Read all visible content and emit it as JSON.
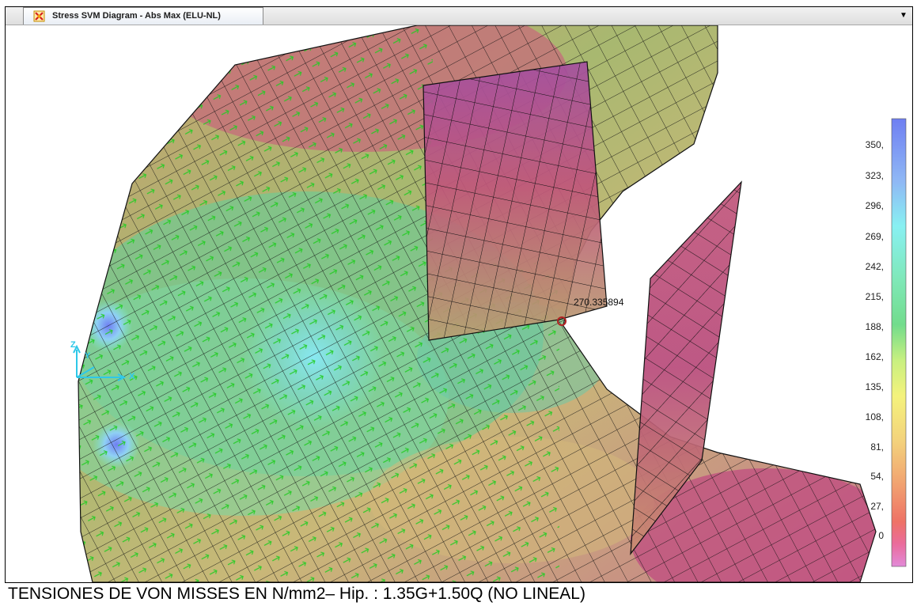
{
  "window": {
    "tab_title": "Stress SVM Diagram - Abs Max  (ELU-NL)",
    "tab_icon": "stress-diagram-icon",
    "dropdown_icon": "chevron-down-icon"
  },
  "viewport": {
    "probe_value": "270.335894",
    "axis_labels": {
      "z": "Z",
      "y": "Y",
      "x": "X"
    }
  },
  "legend": {
    "values": [
      "350,",
      "323,",
      "296,",
      "269,",
      "242,",
      "215,",
      "188,",
      "162,",
      "135,",
      "108,",
      "81,",
      "54,",
      "27,",
      "0"
    ],
    "colors": [
      "#6f7ff2",
      "#7fa9f5",
      "#8fd0f5",
      "#88f0f2",
      "#7fe8c8",
      "#72dc8c",
      "#a8e880",
      "#f4f27c",
      "#f3d27c",
      "#f1b878",
      "#f0986e",
      "#ee7266",
      "#ea6c8c",
      "#e28ad8"
    ]
  },
  "caption": "TENSIONES DE VON MISSES EN N/mm2– Hip. : 1.35G+1.50Q (NO LINEAL)",
  "colors": {
    "mesh_line": "#111111",
    "load_arrows": "#22cc22",
    "probe_marker": "#b22222",
    "axis": "#2ec8e8"
  }
}
